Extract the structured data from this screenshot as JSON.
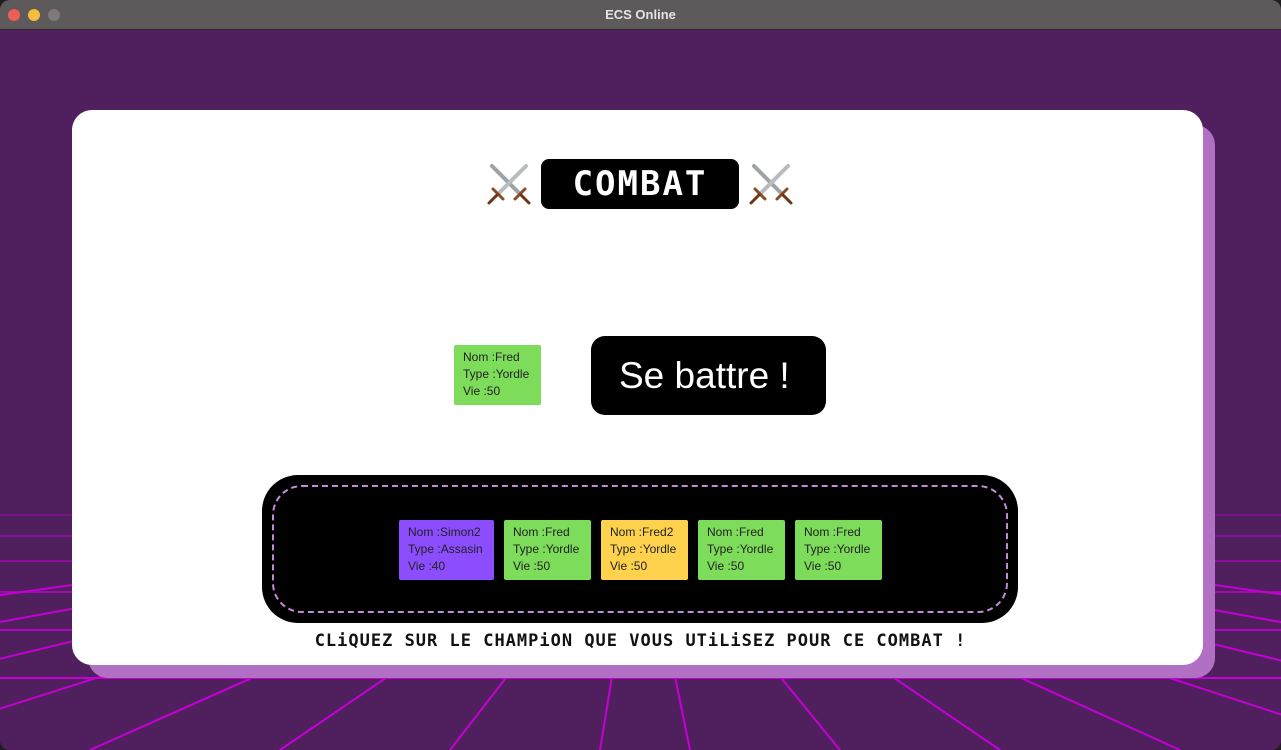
{
  "window": {
    "title": "ECS Online"
  },
  "header": {
    "title": "COMBAT",
    "icon": "crossed-swords"
  },
  "selected_champion": {
    "nom": "Fred",
    "type": "Yordle",
    "vie": "50",
    "color": "#7ddc5a"
  },
  "action": {
    "fight_label": "Se battre !"
  },
  "labels": {
    "nom": "Nom :",
    "type": "Type :",
    "vie": "Vie :"
  },
  "roster": [
    {
      "nom": "Simon2",
      "type": "Assasin",
      "vie": "40",
      "color": "#8c4dff"
    },
    {
      "nom": "Fred",
      "type": "Yordle",
      "vie": "50",
      "color": "#7ddc5a"
    },
    {
      "nom": "Fred2",
      "type": "Yordle",
      "vie": "50",
      "color": "#ffd24d"
    },
    {
      "nom": "Fred",
      "type": "Yordle",
      "vie": "50",
      "color": "#7ddc5a"
    },
    {
      "nom": "Fred",
      "type": "Yordle",
      "vie": "50",
      "color": "#7ddc5a"
    }
  ],
  "instruction": "CLiQUEZ SUR LE CHAMPiON QUE VOUS UTiLiSEZ POUR CE COMBAT !",
  "colors": {
    "background": "#50205e",
    "grid": "#c400d4",
    "card_shadow": "#b170c4"
  }
}
